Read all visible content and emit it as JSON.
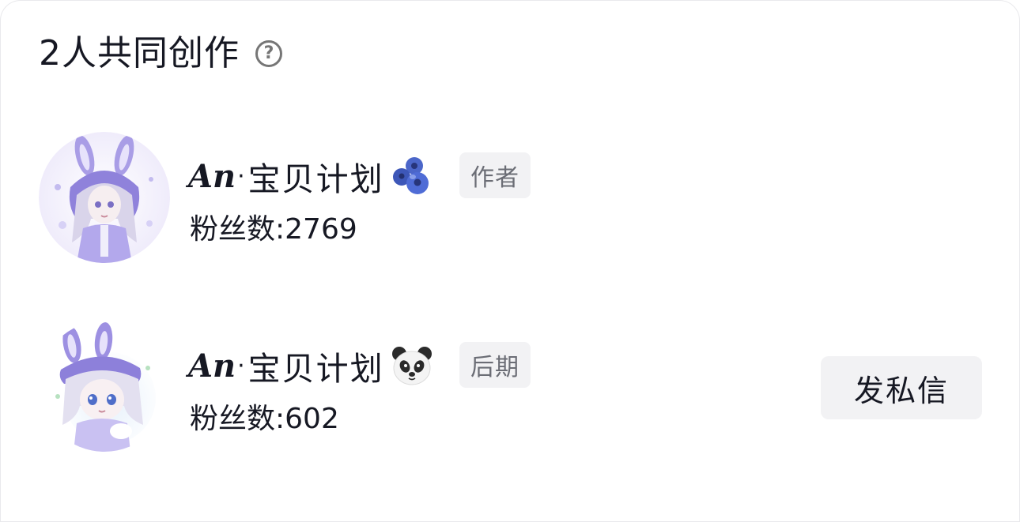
{
  "header": {
    "title": "2人共同创作",
    "help_icon": "?"
  },
  "creators": [
    {
      "name_deco": "𝑨𝒏",
      "name_dot": "·",
      "name_text": "宝贝计划",
      "emoji_icon": "blueberries-icon",
      "role": "作者",
      "fans_label": "粉丝数:",
      "fans_count": "2769"
    },
    {
      "name_deco": "𝑨𝒏",
      "name_dot": "·",
      "name_text": "宝贝计划",
      "emoji_icon": "panda-face-icon",
      "role": "后期",
      "fans_label": "粉丝数:",
      "fans_count": "602",
      "action_label": "发私信"
    }
  ],
  "colors": {
    "text_primary": "#161823",
    "text_secondary": "#6b6d75",
    "tag_bg": "#f2f2f4",
    "accent_lavender": "#9a8fe0"
  }
}
